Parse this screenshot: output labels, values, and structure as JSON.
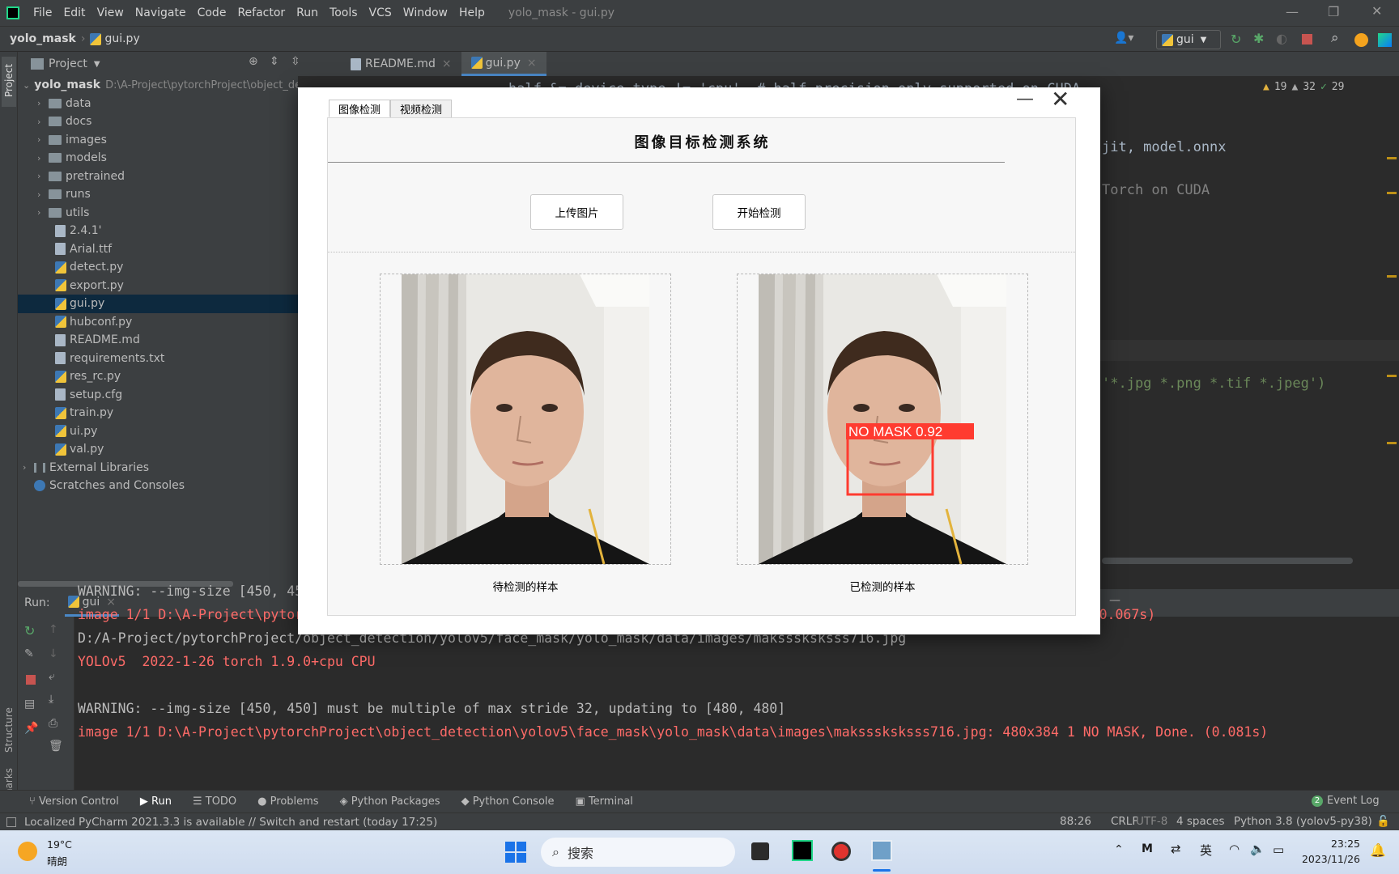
{
  "app": {
    "menu": [
      "File",
      "Edit",
      "View",
      "Navigate",
      "Code",
      "Refactor",
      "Run",
      "Tools",
      "VCS",
      "Window",
      "Help"
    ],
    "window_title": "yolo_mask - gui.py"
  },
  "breadcrumb": {
    "project": "yolo_mask",
    "file": "gui.py"
  },
  "run_config": "gui",
  "project_panel": {
    "title": "Project",
    "root": {
      "name": "yolo_mask",
      "path": "D:\\A-Project\\pytorchProject\\object_detection"
    },
    "folders": [
      "data",
      "docs",
      "images",
      "models",
      "pretrained",
      "runs",
      "utils"
    ],
    "files": [
      "2.4.1'",
      "Arial.ttf",
      "detect.py",
      "export.py",
      "gui.py",
      "hubconf.py",
      "README.md",
      "requirements.txt",
      "res_rc.py",
      "setup.cfg",
      "train.py",
      "ui.py",
      "val.py"
    ],
    "selected": "gui.py",
    "external": "External Libraries",
    "scratches": "Scratches and Consoles"
  },
  "editor": {
    "tabs": [
      "README.md",
      "gui.py"
    ],
    "active_tab": "gui.py",
    "inspections": {
      "warnings_a": "19",
      "warnings_b": "32",
      "ok": "29"
    },
    "code_fragments": [
      "half &= device.type != 'cpu'  # half precision only supported on CUDA",
      "jit, model.onnx",
      "Torch on CUDA",
      "'*.jpg *.png *.tif *.jpeg')"
    ]
  },
  "dialog": {
    "tabs": [
      "图像检测",
      "视频检测"
    ],
    "active_tab": "图像检测",
    "title": "图像目标检测系统",
    "upload_button": "上传图片",
    "detect_button": "开始检测",
    "left_caption": "待检测的样本",
    "right_caption": "已检测的样本",
    "detection_label": "NO MASK 0.92",
    "detection_color": "#ff3b30"
  },
  "run_panel": {
    "label": "Run:",
    "config": "gui",
    "lines": [
      {
        "text": "WARNING: --img-size [450, 450] must be multiple of max stride 32, updating to [480, 480]",
        "color": "plain"
      },
      {
        "text": "image 1/1 D:\\A-Project\\pytorchProject\\object_detection\\yolov5\\face_mask\\yolo_mask\\data\\images\\0476.jpg: 480x320 1 MASK, Done. (0.067s)",
        "color": "red"
      },
      {
        "text": "D:/A-Project/pytorchProject/object_detection/yolov5/face_mask/yolo_mask/data/images/maksssksksss716.jpg",
        "color": "plain"
      },
      {
        "text": "YOLOv5  2022-1-26 torch 1.9.0+cpu CPU",
        "color": "red"
      },
      {
        "text": "",
        "color": "plain"
      },
      {
        "text": "WARNING: --img-size [450, 450] must be multiple of max stride 32, updating to [480, 480]",
        "color": "plain"
      },
      {
        "text": "image 1/1 D:\\A-Project\\pytorchProject\\object_detection\\yolov5\\face_mask\\yolo_mask\\data\\images\\maksssksksss716.jpg: 480x384 1 NO MASK, Done. (0.081s)",
        "color": "red"
      }
    ]
  },
  "tool_tabs": [
    "Version Control",
    "Run",
    "TODO",
    "Problems",
    "Python Packages",
    "Python Console",
    "Terminal"
  ],
  "event_log": {
    "count": "2",
    "label": "Event Log"
  },
  "side_labels": {
    "project": "Project",
    "structure": "Structure",
    "bookmarks": "Bookmarks"
  },
  "status": {
    "message": "Localized PyCharm 2021.3.3 is available // Switch and restart (today 17:25)",
    "position": "88:26",
    "line_sep": "CRLF",
    "encoding": "UTF-8",
    "indent": "4 spaces",
    "interpreter": "Python 3.8 (yolov5-py38)"
  },
  "taskbar": {
    "weather_temp": "19°C",
    "weather_text": "晴朗",
    "search_placeholder": "搜索",
    "ime": "英",
    "time": "23:25",
    "date": "2023/11/26"
  }
}
